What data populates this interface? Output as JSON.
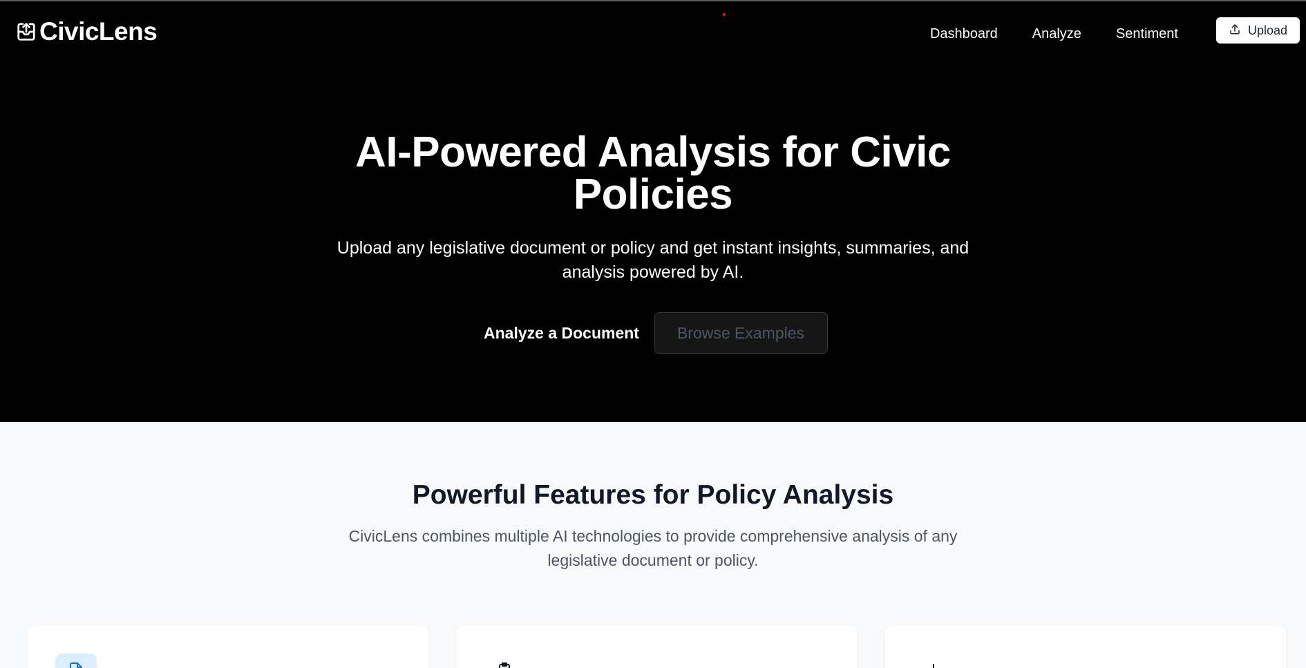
{
  "brand": {
    "name": "CivicLens"
  },
  "nav": {
    "links": [
      "Dashboard",
      "Analyze",
      "Sentiment"
    ],
    "upload_label": "Upload"
  },
  "hero": {
    "title_line1": "AI-Powered Analysis for Civic",
    "title_line2": "Policies",
    "subtitle": "Upload any legislative document or policy and get instant insights, summaries, and analysis powered by AI.",
    "primary_cta": "Analyze a Document",
    "secondary_cta": "Browse Examples"
  },
  "features": {
    "title": "Powerful Features for Policy Analysis",
    "subtitle": "CivicLens combines multiple AI technologies to provide comprehensive analysis of any legislative document or policy."
  },
  "icons": {
    "brand": "inbox-upload-icon",
    "upload": "upload-icon",
    "card1": "document-icon",
    "card2": "clipboard-icon",
    "card3": "chart-icon"
  },
  "colors": {
    "hero_bg": "#000000",
    "features_bg": "#f8f9fb",
    "card_icon_bg": "#dbeefd",
    "heading_dark": "#111827"
  }
}
